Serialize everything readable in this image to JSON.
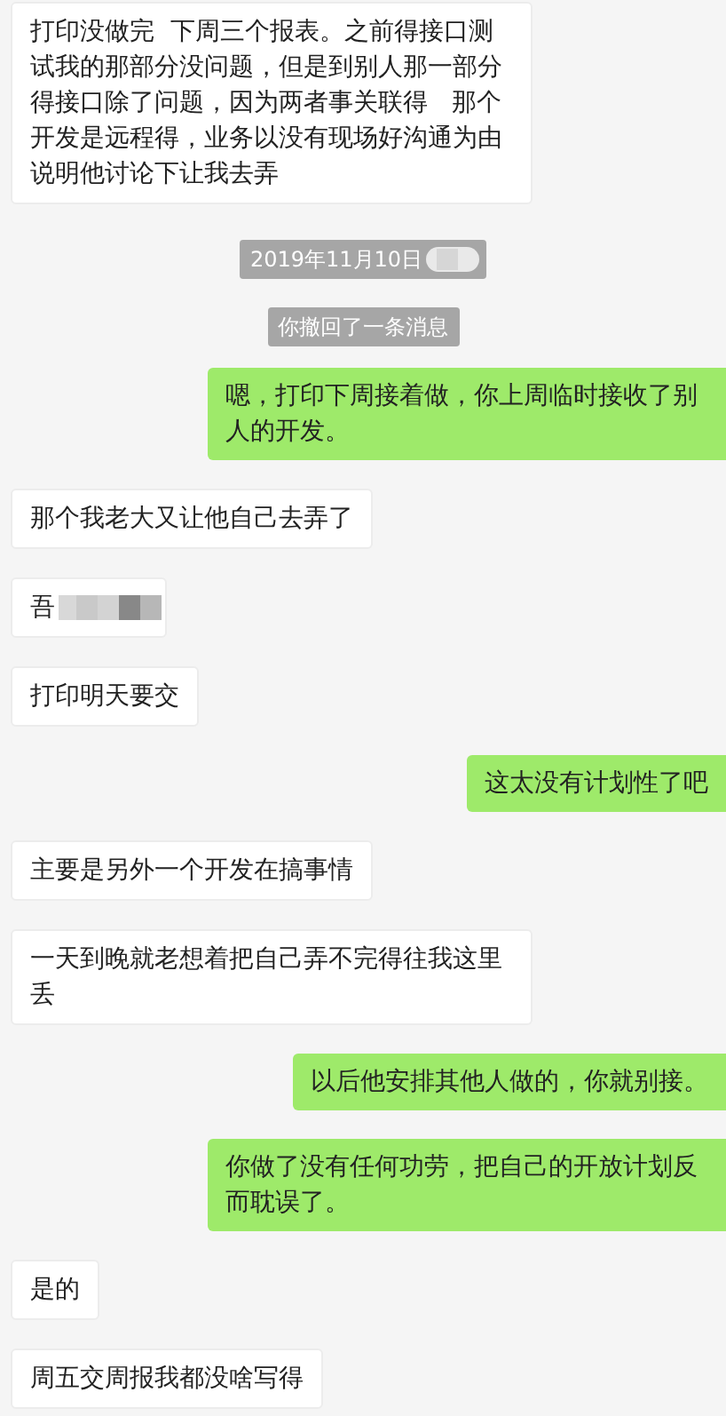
{
  "messages": [
    {
      "kind": "incoming",
      "text": "打印没做完  下周三个报表。之前得接口测试我的那部分没问题，但是到别人那一部分得接口除了问题，因为两者事关联得   那个开发是远程得，业务以没有现场好沟通为由说明他讨论下让我去弄"
    },
    {
      "kind": "timestamp",
      "text": "2019年11月10日"
    },
    {
      "kind": "system",
      "text": "你撤回了一条消息"
    },
    {
      "kind": "outgoing",
      "text": "嗯，打印下周接着做，你上周临时接收了别人的开发。"
    },
    {
      "kind": "incoming",
      "text": "那个我老大又让他自己去弄了"
    },
    {
      "kind": "blurred",
      "text": "吾"
    },
    {
      "kind": "incoming",
      "text": "打印明天要交"
    },
    {
      "kind": "outgoing",
      "text": "这太没有计划性了吧"
    },
    {
      "kind": "incoming",
      "text": "主要是另外一个开发在搞事情"
    },
    {
      "kind": "incoming",
      "text": "一天到晚就老想着把自己弄不完得往我这里丢"
    },
    {
      "kind": "outgoing",
      "text": "以后他安排其他人做的，你就别接。"
    },
    {
      "kind": "outgoing",
      "text": "你做了没有任何功劳，把自己的开放计划反而耽误了。"
    },
    {
      "kind": "incoming",
      "text": "是的"
    },
    {
      "kind": "incoming",
      "text": "周五交周报我都没啥写得"
    }
  ]
}
